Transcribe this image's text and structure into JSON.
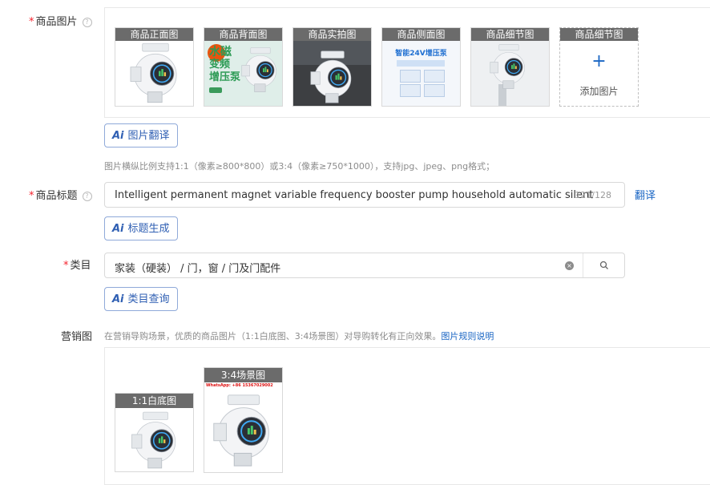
{
  "product_images": {
    "label": "商品图片",
    "thumbs": [
      {
        "caption": "商品正面图"
      },
      {
        "caption": "商品背面图",
        "badge": "水磁",
        "lines": [
          "变频",
          "增压泵"
        ]
      },
      {
        "caption": "商品实拍图"
      },
      {
        "caption": "商品侧面图",
        "headline": "智能24V增压泵"
      },
      {
        "caption": "商品细节图"
      }
    ],
    "add_slot": {
      "caption": "商品细节图",
      "plus": "+",
      "label": "添加图片"
    },
    "ai_button": "图片翻译",
    "hint": "图片横纵比例支持1:1（像素≥800*800）或3:4（像素≥750*1000），支持jpg、jpeg、png格式；"
  },
  "title_field": {
    "label": "商品标题",
    "value": "Intelligent permanent magnet variable frequency booster pump household automatic silent",
    "counter": "121/128",
    "translate_link": "翻译",
    "ai_button": "标题生成"
  },
  "category_field": {
    "label": "类目",
    "value": "家装（硬装） / 门，窗 / 门及门配件",
    "ai_button": "类目查询"
  },
  "marketing": {
    "label": "营销图",
    "hint": "在营销导购场景，优质的商品图片（1:1白底图、3:4场景图）对导购转化有正向效果。",
    "rules_link": "图片规则说明",
    "thumbs": [
      {
        "caption": "1:1白底图"
      },
      {
        "caption": "3:4场景图",
        "watermark": "WhatsApp: +86 15367029002"
      }
    ]
  },
  "colors": {
    "required": "#f5222d",
    "link": "#1a66c4",
    "ai_border": "#8fa9d9",
    "caption_bg": "#6b6b6b"
  }
}
